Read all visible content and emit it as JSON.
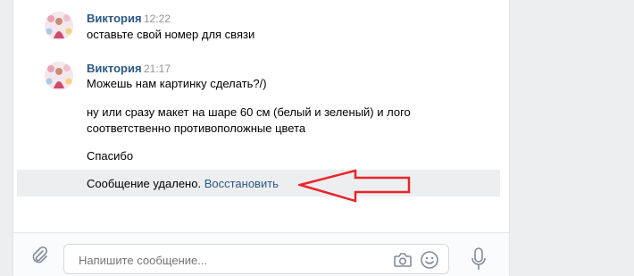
{
  "messages": [
    {
      "author": "Виктория",
      "time": "12:22",
      "lines": [
        "оставьте свой номер для связи"
      ]
    },
    {
      "author": "Виктория",
      "time": "21:17",
      "lines": [
        "Можешь нам картинку сделать?/)",
        "ну или сразу макет на шаре 60 см (белый и зеленый) и лого",
        "соответственно противоположные цвета",
        "Спасибо"
      ]
    }
  ],
  "deleted": {
    "text": "Сообщение удалено.",
    "restore_label": "Восстановить"
  },
  "composer": {
    "placeholder": "Напишите сообщение..."
  },
  "icons": {
    "attach": "paperclip-icon",
    "camera": "camera-icon",
    "emoji": "smile-icon",
    "voice": "microphone-icon"
  },
  "colors": {
    "link": "#2a5885",
    "time": "#939393",
    "arrow": "#e8262b",
    "deleted_bg": "#edeef0"
  }
}
